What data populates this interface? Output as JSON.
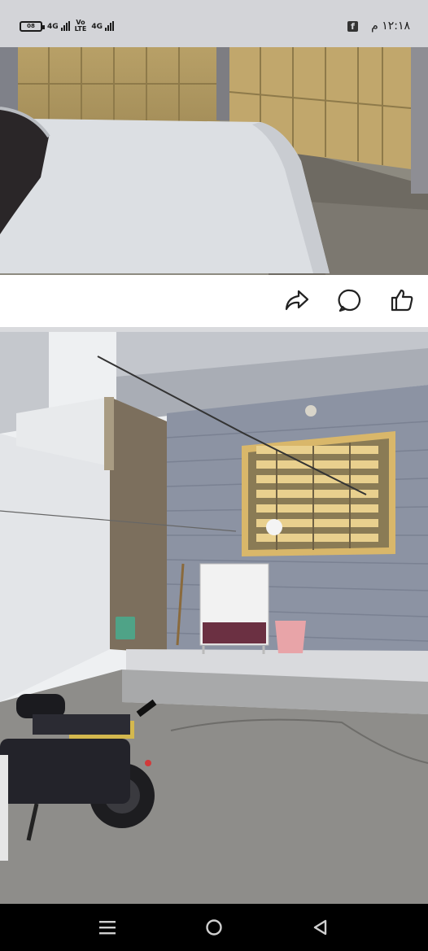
{
  "status_bar": {
    "battery": "08",
    "sim1_network": "4G",
    "volte_line1": "Vo",
    "volte_line2": "LTE",
    "sim2_network": "4G",
    "time": "١٢:١٨ م",
    "notification_icon": "facebook-icon"
  },
  "post_actions": {
    "icons": [
      "share-icon",
      "comment-icon",
      "like-icon"
    ]
  },
  "photos": [
    {
      "subject": "white car parked in front of yellow gate"
    },
    {
      "subject": "house courtyard with washing machine and motorbike"
    }
  ],
  "nav_bar": {
    "icons": [
      "recent-apps-icon",
      "home-icon",
      "back-icon"
    ]
  },
  "colors": {
    "status_bar_bg": "#d3d4d8",
    "nav_bar_bg": "#000000",
    "separator": "#d9dadd"
  }
}
